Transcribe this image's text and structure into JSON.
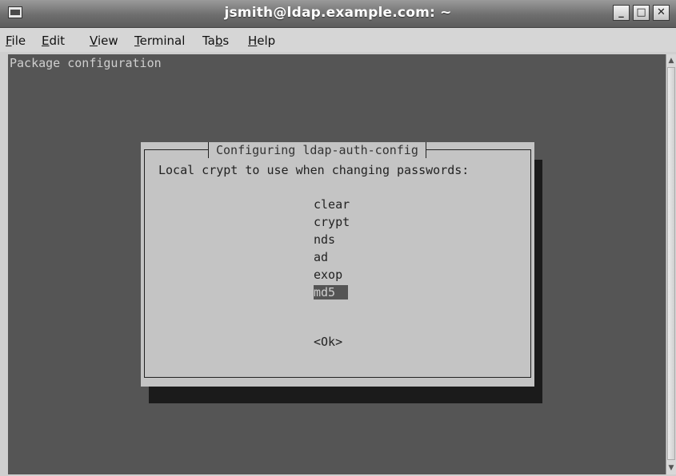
{
  "window": {
    "title": "jsmith@ldap.example.com: ~",
    "buttons": {
      "minimize": "_",
      "maximize": "□",
      "close": "✕"
    }
  },
  "menubar": {
    "items": [
      {
        "mnemonic": "F",
        "rest": "ile"
      },
      {
        "mnemonic": "E",
        "rest": "dit"
      },
      {
        "mnemonic": "V",
        "rest": "iew"
      },
      {
        "mnemonic": "T",
        "rest": "erminal"
      },
      {
        "pre": "Ta",
        "mnemonic": "b",
        "rest": "s"
      },
      {
        "mnemonic": "H",
        "rest": "elp"
      }
    ]
  },
  "terminal": {
    "header": "Package configuration",
    "dialog": {
      "title": "Configuring ldap-auth-config",
      "prompt": "Local crypt to use when changing passwords:",
      "options": [
        "clear",
        "crypt",
        "nds",
        "ad",
        "exop",
        "md5"
      ],
      "selected_option": "md5",
      "ok_label": "<Ok>"
    }
  },
  "colors": {
    "terminal_bg": "#555555",
    "dialog_bg": "#c4c4c4",
    "selection_bg": "#555555"
  }
}
